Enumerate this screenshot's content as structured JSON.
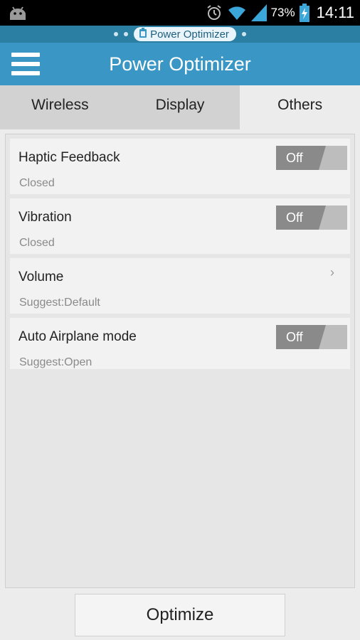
{
  "status_bar": {
    "battery_percent": "73%",
    "time": "14:11",
    "icons": [
      "android-icon",
      "alarm-icon",
      "wifi-icon",
      "signal-icon",
      "battery-charging-icon"
    ]
  },
  "notification_strip": {
    "label": "Power Optimizer",
    "icon": "battery-icon"
  },
  "app_bar": {
    "title": "Power Optimizer",
    "menu_icon": "hamburger-menu-icon"
  },
  "tabs": [
    {
      "label": "Wireless",
      "active": false
    },
    {
      "label": "Display",
      "active": false
    },
    {
      "label": "Others",
      "active": true
    }
  ],
  "settings": [
    {
      "title": "Haptic Feedback",
      "subtitle": "Closed",
      "control": "toggle",
      "toggle_label": "Off"
    },
    {
      "title": "Vibration",
      "subtitle": "Closed",
      "control": "toggle",
      "toggle_label": "Off"
    },
    {
      "title": "Volume",
      "subtitle": "Suggest:Default",
      "control": "chevron",
      "chevron": "›"
    },
    {
      "title": "Auto Airplane mode",
      "subtitle": "Suggest:Open",
      "control": "toggle",
      "toggle_label": "Off"
    }
  ],
  "optimize_button": {
    "label": "Optimize"
  },
  "colors": {
    "app_bar": "#3a97c5",
    "strip": "#2b7fa3",
    "toggle_off": "#8a8a8a",
    "toggle_track": "#bdbdbd"
  }
}
